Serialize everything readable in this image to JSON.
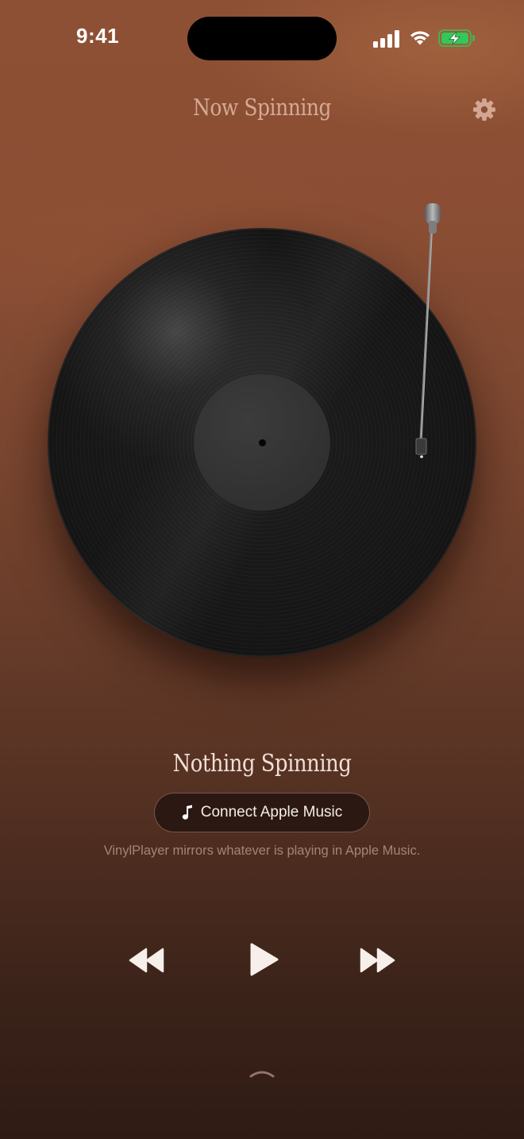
{
  "status_bar": {
    "time": "9:41",
    "icons": [
      "signal-icon",
      "wifi-icon",
      "battery-charging-icon"
    ],
    "battery_color": "#34c759"
  },
  "header": {
    "title": "Now Spinning",
    "settings_icon": "gear-icon"
  },
  "turntable": {
    "record_color": "#161616",
    "label_color": "#333333",
    "tonearm_icon": "tonearm"
  },
  "track": {
    "title": "Nothing Spinning",
    "connect_button": {
      "icon": "music-note-icon",
      "label": "Connect Apple Music"
    },
    "hint": "VinylPlayer mirrors whatever is playing in Apple Music."
  },
  "transport": {
    "rewind_icon": "rewind-icon",
    "play_icon": "play-icon",
    "forward_icon": "fast-forward-icon"
  },
  "bottom": {
    "expand_icon": "chevron-up-icon"
  },
  "colors": {
    "background_top": "#8e5034",
    "background_bottom": "#2f1b14",
    "accent_text": "#e2b9a4",
    "button_background": "#2b1812"
  }
}
